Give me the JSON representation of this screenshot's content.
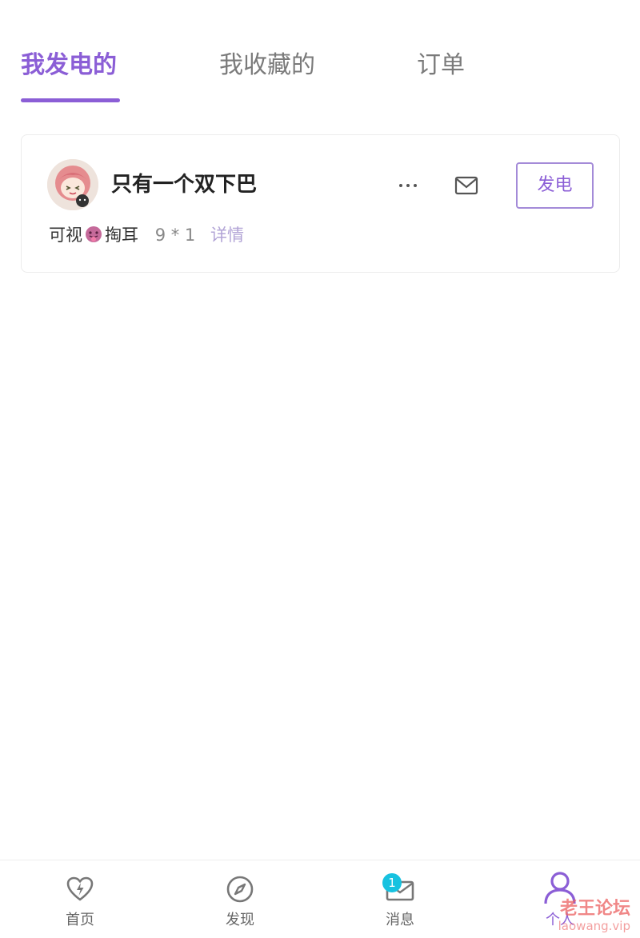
{
  "tabs": [
    {
      "label": "我发电的",
      "active": true
    },
    {
      "label": "我收藏的",
      "active": false
    },
    {
      "label": "订单",
      "active": false
    }
  ],
  "card": {
    "name": "只有一个双下巴",
    "button_label": "发电",
    "desc_prefix": "可视",
    "desc_emoji": "tongue-emoji",
    "desc_suffix": "掏耳",
    "quantity": "9 * 1",
    "detail_label": "详情"
  },
  "bottom_nav": [
    {
      "label": "首页",
      "icon": "heart-bolt-icon"
    },
    {
      "label": "发现",
      "icon": "compass-icon"
    },
    {
      "label": "消息",
      "icon": "mail-icon",
      "badge": "1"
    },
    {
      "label": "个人",
      "icon": "person-icon",
      "active": true
    }
  ],
  "watermark": {
    "title": "老王论坛",
    "url": "laowang.vip"
  },
  "colors": {
    "accent": "#8b5ed6",
    "badge": "#17c2e0",
    "detail": "#b2a4d6"
  }
}
